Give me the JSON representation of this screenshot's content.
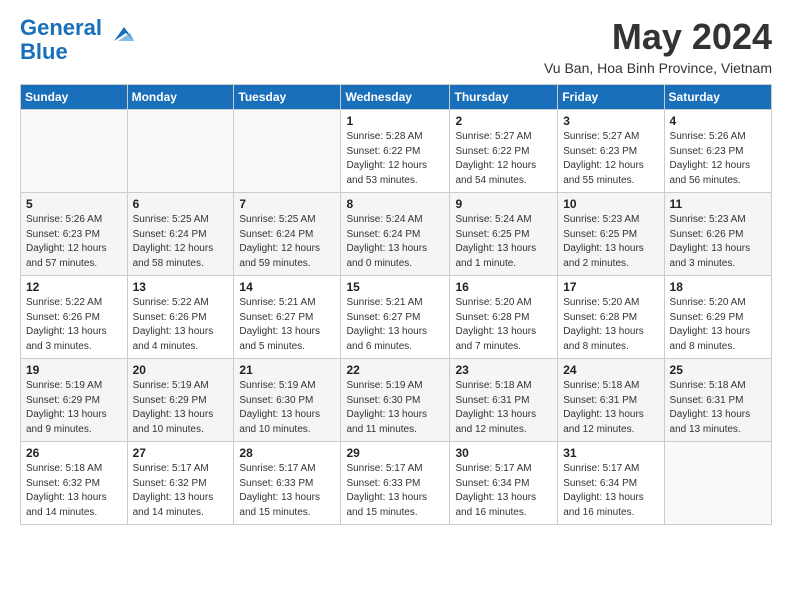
{
  "logo": {
    "line1": "General",
    "line2": "Blue"
  },
  "title": "May 2024",
  "location": "Vu Ban, Hoa Binh Province, Vietnam",
  "headers": [
    "Sunday",
    "Monday",
    "Tuesday",
    "Wednesday",
    "Thursday",
    "Friday",
    "Saturday"
  ],
  "weeks": [
    [
      {
        "num": "",
        "info": ""
      },
      {
        "num": "",
        "info": ""
      },
      {
        "num": "",
        "info": ""
      },
      {
        "num": "1",
        "info": "Sunrise: 5:28 AM\nSunset: 6:22 PM\nDaylight: 12 hours\nand 53 minutes."
      },
      {
        "num": "2",
        "info": "Sunrise: 5:27 AM\nSunset: 6:22 PM\nDaylight: 12 hours\nand 54 minutes."
      },
      {
        "num": "3",
        "info": "Sunrise: 5:27 AM\nSunset: 6:23 PM\nDaylight: 12 hours\nand 55 minutes."
      },
      {
        "num": "4",
        "info": "Sunrise: 5:26 AM\nSunset: 6:23 PM\nDaylight: 12 hours\nand 56 minutes."
      }
    ],
    [
      {
        "num": "5",
        "info": "Sunrise: 5:26 AM\nSunset: 6:23 PM\nDaylight: 12 hours\nand 57 minutes."
      },
      {
        "num": "6",
        "info": "Sunrise: 5:25 AM\nSunset: 6:24 PM\nDaylight: 12 hours\nand 58 minutes."
      },
      {
        "num": "7",
        "info": "Sunrise: 5:25 AM\nSunset: 6:24 PM\nDaylight: 12 hours\nand 59 minutes."
      },
      {
        "num": "8",
        "info": "Sunrise: 5:24 AM\nSunset: 6:24 PM\nDaylight: 13 hours\nand 0 minutes."
      },
      {
        "num": "9",
        "info": "Sunrise: 5:24 AM\nSunset: 6:25 PM\nDaylight: 13 hours\nand 1 minute."
      },
      {
        "num": "10",
        "info": "Sunrise: 5:23 AM\nSunset: 6:25 PM\nDaylight: 13 hours\nand 2 minutes."
      },
      {
        "num": "11",
        "info": "Sunrise: 5:23 AM\nSunset: 6:26 PM\nDaylight: 13 hours\nand 3 minutes."
      }
    ],
    [
      {
        "num": "12",
        "info": "Sunrise: 5:22 AM\nSunset: 6:26 PM\nDaylight: 13 hours\nand 3 minutes."
      },
      {
        "num": "13",
        "info": "Sunrise: 5:22 AM\nSunset: 6:26 PM\nDaylight: 13 hours\nand 4 minutes."
      },
      {
        "num": "14",
        "info": "Sunrise: 5:21 AM\nSunset: 6:27 PM\nDaylight: 13 hours\nand 5 minutes."
      },
      {
        "num": "15",
        "info": "Sunrise: 5:21 AM\nSunset: 6:27 PM\nDaylight: 13 hours\nand 6 minutes."
      },
      {
        "num": "16",
        "info": "Sunrise: 5:20 AM\nSunset: 6:28 PM\nDaylight: 13 hours\nand 7 minutes."
      },
      {
        "num": "17",
        "info": "Sunrise: 5:20 AM\nSunset: 6:28 PM\nDaylight: 13 hours\nand 8 minutes."
      },
      {
        "num": "18",
        "info": "Sunrise: 5:20 AM\nSunset: 6:29 PM\nDaylight: 13 hours\nand 8 minutes."
      }
    ],
    [
      {
        "num": "19",
        "info": "Sunrise: 5:19 AM\nSunset: 6:29 PM\nDaylight: 13 hours\nand 9 minutes."
      },
      {
        "num": "20",
        "info": "Sunrise: 5:19 AM\nSunset: 6:29 PM\nDaylight: 13 hours\nand 10 minutes."
      },
      {
        "num": "21",
        "info": "Sunrise: 5:19 AM\nSunset: 6:30 PM\nDaylight: 13 hours\nand 10 minutes."
      },
      {
        "num": "22",
        "info": "Sunrise: 5:19 AM\nSunset: 6:30 PM\nDaylight: 13 hours\nand 11 minutes."
      },
      {
        "num": "23",
        "info": "Sunrise: 5:18 AM\nSunset: 6:31 PM\nDaylight: 13 hours\nand 12 minutes."
      },
      {
        "num": "24",
        "info": "Sunrise: 5:18 AM\nSunset: 6:31 PM\nDaylight: 13 hours\nand 12 minutes."
      },
      {
        "num": "25",
        "info": "Sunrise: 5:18 AM\nSunset: 6:31 PM\nDaylight: 13 hours\nand 13 minutes."
      }
    ],
    [
      {
        "num": "26",
        "info": "Sunrise: 5:18 AM\nSunset: 6:32 PM\nDaylight: 13 hours\nand 14 minutes."
      },
      {
        "num": "27",
        "info": "Sunrise: 5:17 AM\nSunset: 6:32 PM\nDaylight: 13 hours\nand 14 minutes."
      },
      {
        "num": "28",
        "info": "Sunrise: 5:17 AM\nSunset: 6:33 PM\nDaylight: 13 hours\nand 15 minutes."
      },
      {
        "num": "29",
        "info": "Sunrise: 5:17 AM\nSunset: 6:33 PM\nDaylight: 13 hours\nand 15 minutes."
      },
      {
        "num": "30",
        "info": "Sunrise: 5:17 AM\nSunset: 6:34 PM\nDaylight: 13 hours\nand 16 minutes."
      },
      {
        "num": "31",
        "info": "Sunrise: 5:17 AM\nSunset: 6:34 PM\nDaylight: 13 hours\nand 16 minutes."
      },
      {
        "num": "",
        "info": ""
      }
    ]
  ]
}
